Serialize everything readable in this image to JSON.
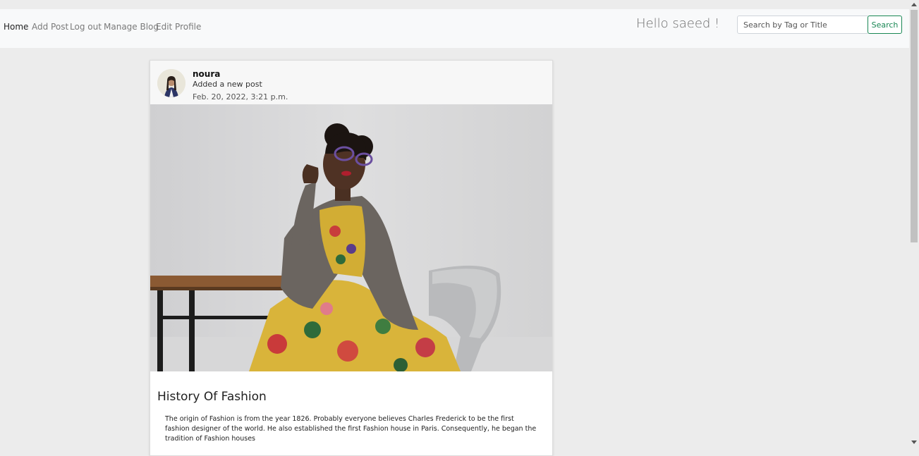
{
  "navbar": {
    "links": [
      {
        "label": "Home",
        "active": true
      },
      {
        "label": "Add Post",
        "active": false
      },
      {
        "label": "Log out",
        "active": false
      },
      {
        "label": "Manage Blog",
        "active": false
      },
      {
        "label": "Edit Profile",
        "active": false
      }
    ],
    "greeting": "Hello saeed !",
    "search": {
      "placeholder": "Search by Tag or Title",
      "value": "",
      "button_label": "Search"
    }
  },
  "post": {
    "author": "noura",
    "action": "Added a new post",
    "date": "Feb. 20, 2022, 3:21 p.m.",
    "title": "History Of Fashion",
    "body": "The origin of Fashion is from the year 1826. Probably everyone believes Charles Frederick to be the first fashion designer of the world. He also established the first Fashion house in Paris. Consequently, he began the tradition of Fashion houses"
  },
  "colors": {
    "page_bg": "#ececec",
    "navbar_bg": "#f8f9fa",
    "accent_green": "#198754"
  }
}
